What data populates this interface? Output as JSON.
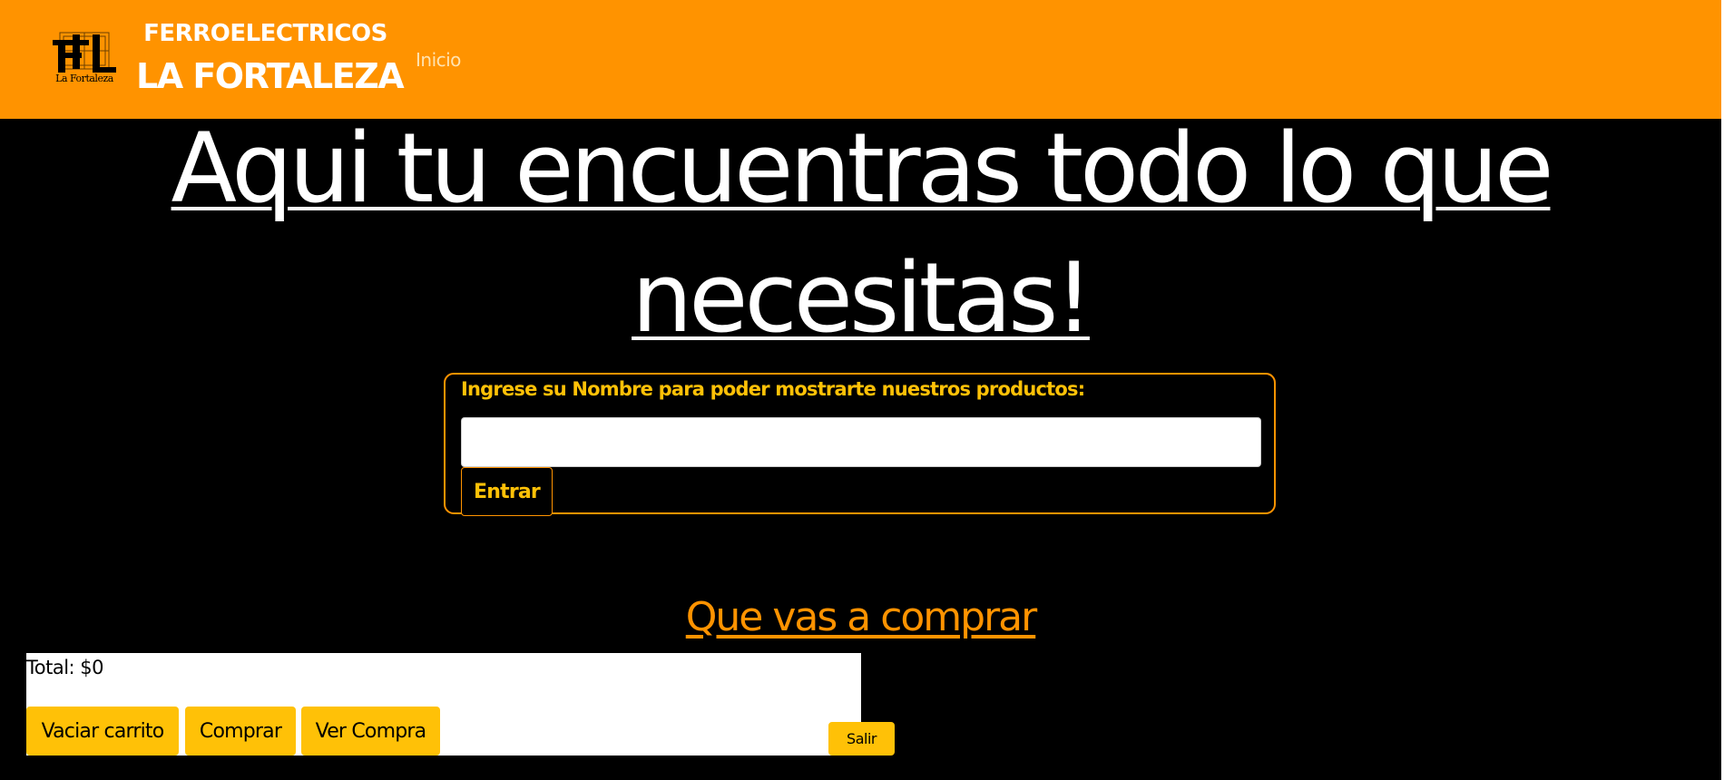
{
  "header": {
    "logo_icon": "la-fortaleza-logo-icon",
    "logo_text": "La Fortaleza",
    "brand_line1": "FERROELECTRICOS",
    "brand_line2": "LA FORTALEZA",
    "nav": {
      "inicio_label": "Inicio"
    }
  },
  "hero": {
    "line1": "Aqui tu encuentras todo lo que",
    "line2": "necesitas!"
  },
  "login": {
    "label": "Ingrese su Nombre para poder mostrarte nuestros productos:",
    "name_value": "",
    "name_placeholder": "",
    "submit_label": "Entrar"
  },
  "shop": {
    "title": "Que vas a comprar"
  },
  "cart": {
    "total_text": "Total: $0",
    "buttons": {
      "empty_label": "Vaciar carrito",
      "buy_label": "Comprar",
      "view_label": "Ver Compra"
    },
    "exit_label": "Salir"
  },
  "colors": {
    "header_bg": "#ff9300",
    "accent_yellow": "#ffc107",
    "page_bg": "#000000",
    "text_white": "#ffffff"
  }
}
